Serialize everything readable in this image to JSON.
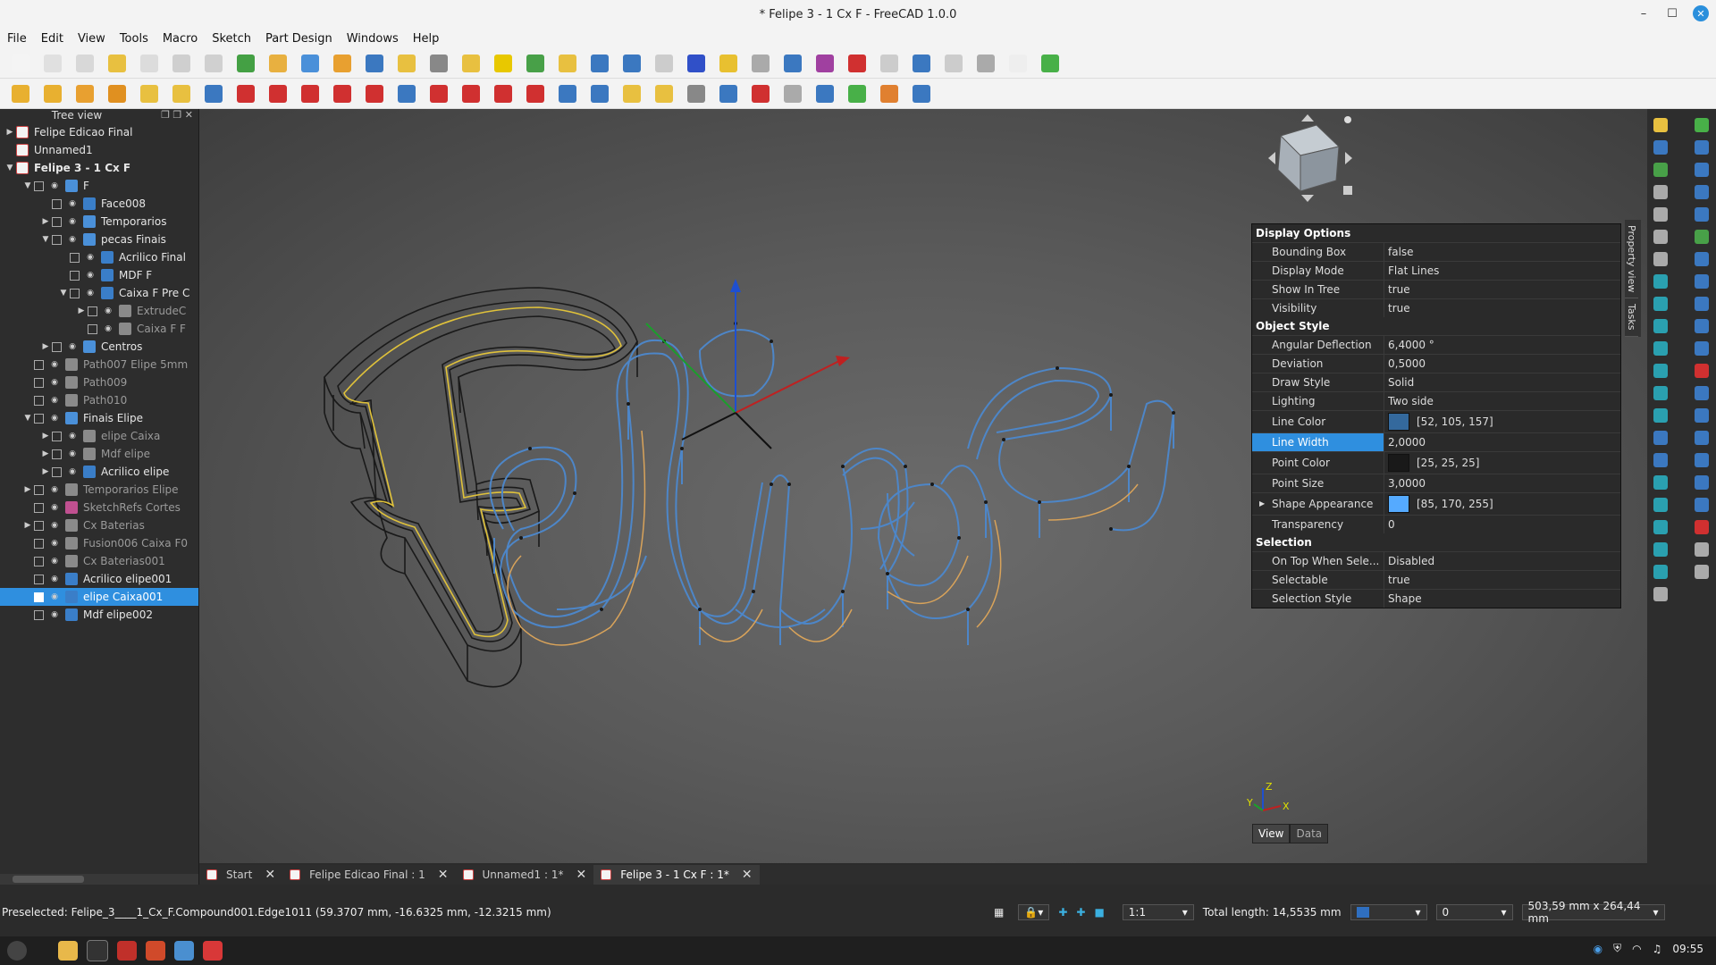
{
  "window": {
    "title": "* Felipe 3 - 1 Cx F - FreeCAD 1.0.0"
  },
  "menu": [
    "File",
    "Edit",
    "View",
    "Tools",
    "Macro",
    "Sketch",
    "Part Design",
    "Windows",
    "Help"
  ],
  "tree": {
    "title": "Tree view",
    "rows": [
      {
        "label": "Felipe Edicao Final",
        "depth": 0,
        "arrow": "▶",
        "cb": false,
        "eye": false,
        "icon": "doc",
        "dim": false
      },
      {
        "label": "Unnamed1",
        "depth": 0,
        "arrow": "",
        "cb": false,
        "eye": false,
        "icon": "doc",
        "dim": false
      },
      {
        "label": "Felipe 3  - 1 Cx F",
        "depth": 0,
        "arrow": "▼",
        "cb": false,
        "eye": false,
        "icon": "doc",
        "dim": false,
        "bold": true
      },
      {
        "label": "F",
        "depth": 1,
        "arrow": "▼",
        "cb": true,
        "eye": true,
        "icon": "folder",
        "dim": false
      },
      {
        "label": "Face008",
        "depth": 2,
        "arrow": "",
        "cb": true,
        "eye": true,
        "icon": "part",
        "dim": false
      },
      {
        "label": "Temporarios",
        "depth": 2,
        "arrow": "▶",
        "cb": true,
        "eye": true,
        "icon": "folder",
        "dim": false
      },
      {
        "label": "pecas Finais",
        "depth": 2,
        "arrow": "▼",
        "cb": true,
        "eye": true,
        "icon": "folder",
        "dim": false
      },
      {
        "label": "Acrilico Final",
        "depth": 3,
        "arrow": "",
        "cb": true,
        "eye": true,
        "icon": "part",
        "dim": false
      },
      {
        "label": "MDF F",
        "depth": 3,
        "arrow": "",
        "cb": true,
        "eye": true,
        "icon": "part",
        "dim": false
      },
      {
        "label": "Caixa F Pre C",
        "depth": 3,
        "arrow": "▼",
        "cb": true,
        "eye": true,
        "icon": "part",
        "dim": false
      },
      {
        "label": "ExtrudeC",
        "depth": 4,
        "arrow": "▶",
        "cb": true,
        "eye": true,
        "icon": "grey",
        "dim": true
      },
      {
        "label": "Caixa F F",
        "depth": 4,
        "arrow": "",
        "cb": true,
        "eye": true,
        "icon": "grey",
        "dim": true
      },
      {
        "label": "Centros",
        "depth": 2,
        "arrow": "▶",
        "cb": true,
        "eye": true,
        "icon": "folder",
        "dim": false
      },
      {
        "label": "Path007 Elipe 5mm",
        "depth": 1,
        "arrow": "",
        "cb": true,
        "eye": true,
        "icon": "grey",
        "dim": true
      },
      {
        "label": "Path009",
        "depth": 1,
        "arrow": "",
        "cb": true,
        "eye": true,
        "icon": "grey",
        "dim": true
      },
      {
        "label": "Path010",
        "depth": 1,
        "arrow": "",
        "cb": true,
        "eye": true,
        "icon": "grey",
        "dim": true
      },
      {
        "label": "Finais Elipe",
        "depth": 1,
        "arrow": "▼",
        "cb": true,
        "eye": true,
        "icon": "folder",
        "dim": false
      },
      {
        "label": "elipe Caixa",
        "depth": 2,
        "arrow": "▶",
        "cb": true,
        "eye": true,
        "icon": "grey",
        "dim": true
      },
      {
        "label": "Mdf elipe",
        "depth": 2,
        "arrow": "▶",
        "cb": true,
        "eye": true,
        "icon": "grey",
        "dim": true
      },
      {
        "label": "Acrilico elipe",
        "depth": 2,
        "arrow": "▶",
        "cb": true,
        "eye": true,
        "icon": "part",
        "dim": false
      },
      {
        "label": "Temporarios Elipe",
        "depth": 1,
        "arrow": "▶",
        "cb": true,
        "eye": true,
        "icon": "grey",
        "dim": true
      },
      {
        "label": "SketchRefs Cortes",
        "depth": 1,
        "arrow": "",
        "cb": true,
        "eye": true,
        "icon": "sketch",
        "dim": true
      },
      {
        "label": "Cx Baterias",
        "depth": 1,
        "arrow": "▶",
        "cb": true,
        "eye": true,
        "icon": "grey",
        "dim": true
      },
      {
        "label": "Fusion006 Caixa F0",
        "depth": 1,
        "arrow": "",
        "cb": true,
        "eye": true,
        "icon": "grey",
        "dim": true
      },
      {
        "label": "Cx Baterias001",
        "depth": 1,
        "arrow": "",
        "cb": true,
        "eye": true,
        "icon": "grey",
        "dim": true
      },
      {
        "label": "Acrilico elipe001",
        "depth": 1,
        "arrow": "",
        "cb": true,
        "eye": true,
        "icon": "part",
        "dim": false
      },
      {
        "label": "elipe Caixa001",
        "depth": 1,
        "arrow": "",
        "cb": true,
        "eye": true,
        "icon": "part",
        "dim": false,
        "selected": true
      },
      {
        "label": "Mdf elipe002",
        "depth": 1,
        "arrow": "",
        "cb": true,
        "eye": true,
        "icon": "part",
        "dim": false
      }
    ]
  },
  "properties": {
    "sections": [
      {
        "title": "Display Options",
        "rows": [
          {
            "name": "Bounding Box",
            "value": "false"
          },
          {
            "name": "Display Mode",
            "value": "Flat Lines"
          },
          {
            "name": "Show In Tree",
            "value": "true"
          },
          {
            "name": "Visibility",
            "value": "true"
          }
        ]
      },
      {
        "title": "Object Style",
        "rows": [
          {
            "name": "Angular Deflection",
            "value": "6,4000 °"
          },
          {
            "name": "Deviation",
            "value": "0,5000"
          },
          {
            "name": "Draw Style",
            "value": "Solid"
          },
          {
            "name": "Lighting",
            "value": "Two side"
          },
          {
            "name": "Line Color",
            "value": "[52, 105, 157]",
            "swatch": "#34699d",
            "tall": true
          },
          {
            "name": "Line Width",
            "value": "2,0000",
            "selected": true
          },
          {
            "name": "Point Color",
            "value": "[25, 25, 25]",
            "swatch": "#191919",
            "tall": true
          },
          {
            "name": "Point Size",
            "value": "3,0000"
          },
          {
            "name": "Shape Appearance",
            "value": "[85, 170, 255]",
            "swatch": "#55aaff",
            "tall": true,
            "expand": true
          },
          {
            "name": "Transparency",
            "value": "0"
          }
        ]
      },
      {
        "title": "Selection",
        "rows": [
          {
            "name": "On Top When Sele...",
            "value": "Disabled"
          },
          {
            "name": "Selectable",
            "value": "true"
          },
          {
            "name": "Selection Style",
            "value": "Shape"
          }
        ]
      }
    ]
  },
  "side_tabs": [
    "Property view",
    "Tasks"
  ],
  "view_data_tabs": [
    "View",
    "Data"
  ],
  "doc_tabs": [
    {
      "label": "Start",
      "active": false
    },
    {
      "label": "Felipe Edicao Final : 1",
      "active": false
    },
    {
      "label": "Unnamed1 : 1*",
      "active": false
    },
    {
      "label": "Felipe 3 - 1 Cx F : 1*",
      "active": true
    }
  ],
  "status": {
    "preselected": "Preselected: Felipe_3____1_Cx_F.Compound001.Edge1011 (59.3707 mm, -16.6325 mm, -12.3215 mm)",
    "zoom": "1:1",
    "total_length": "Total length: 14,5535 mm",
    "value_field": "0",
    "dimensions": "503,59 mm x 264,44 mm"
  },
  "axis_labels": {
    "x": "X",
    "y": "Y",
    "z": "Z"
  },
  "taskbar": {
    "time": "09:55"
  },
  "colors": {
    "accent": "#2f8fdf",
    "wire_blue": "#4d86c8",
    "wire_orange": "#d9a35a",
    "wire_yellow": "#e0c23a"
  }
}
